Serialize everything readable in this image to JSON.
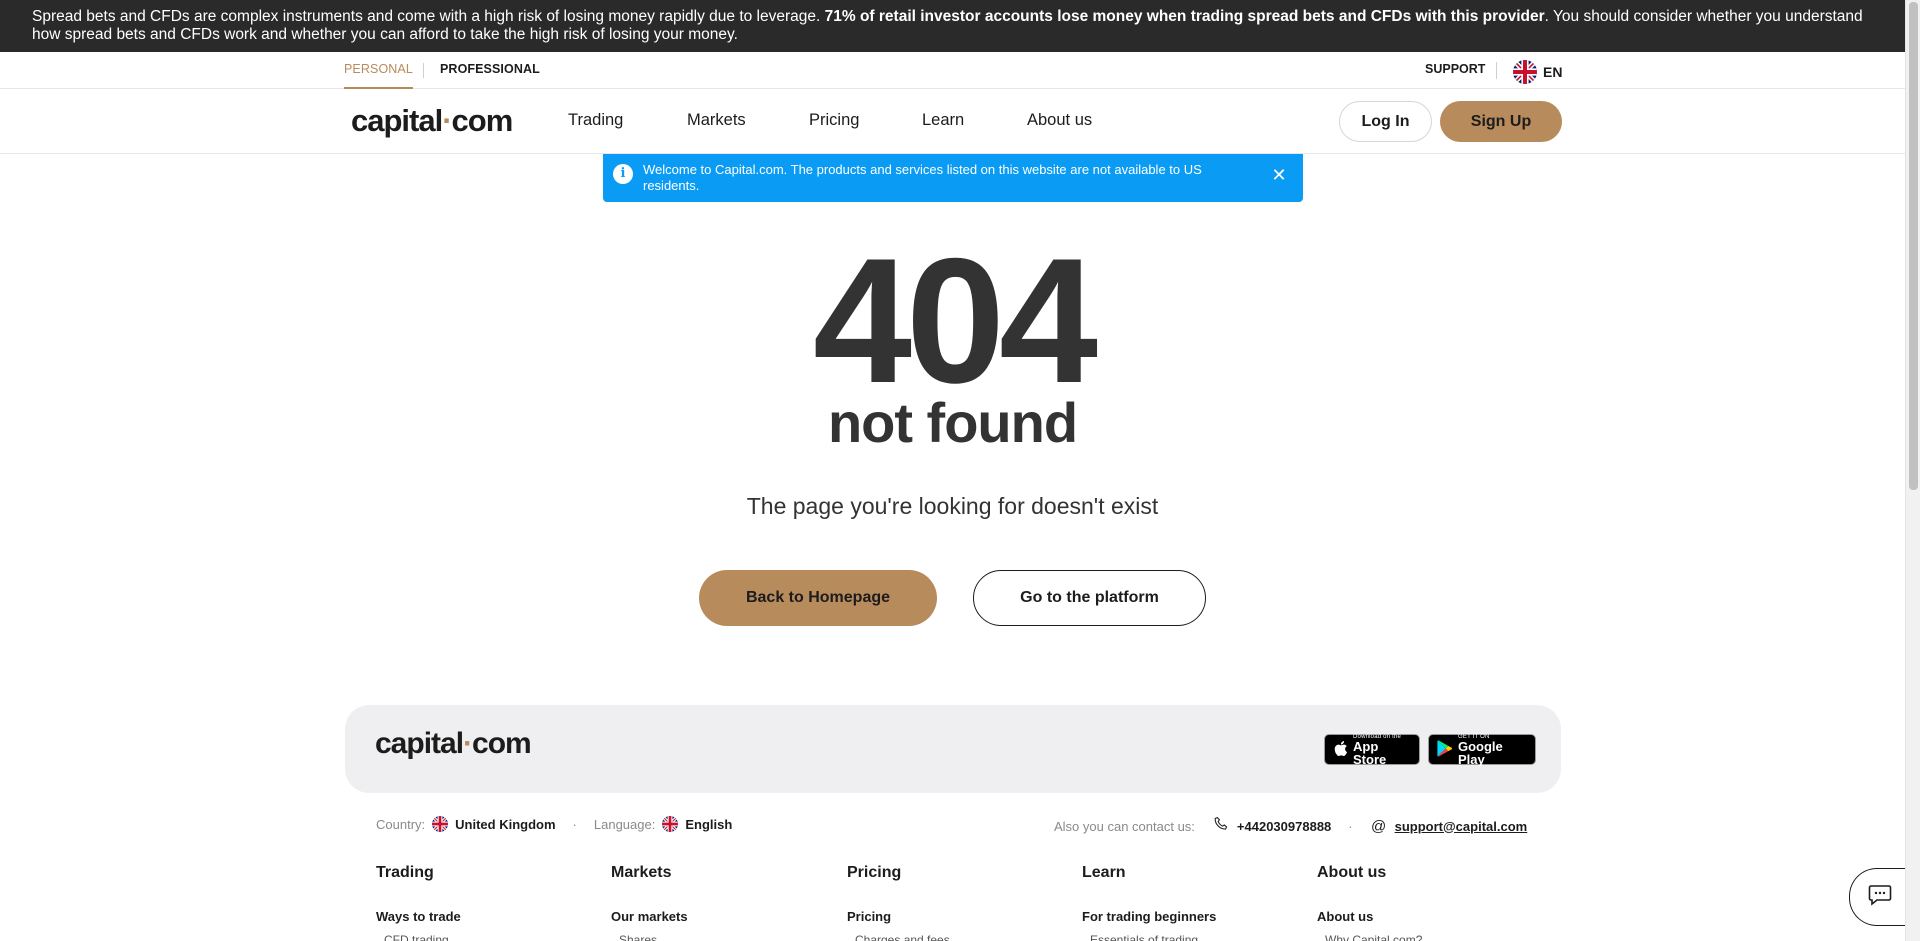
{
  "risk_banner": {
    "text_start": "Spread bets and CFDs are complex instruments and come with a high risk of losing money rapidly due to leverage. ",
    "text_bold": "71% of retail investor accounts lose money when trading spread bets and CFDs with this provider",
    "text_end": ". You should consider whether you understand how spread bets and CFDs work and whether you can afford to take the high risk of losing your money."
  },
  "topbar": {
    "personal": "PERSONAL",
    "professional": "PROFESSIONAL",
    "support": "SUPPORT",
    "language_code": "EN"
  },
  "nav": {
    "logo_left": "capital",
    "logo_dot": "·",
    "logo_right": "com",
    "items": [
      "Trading",
      "Markets",
      "Pricing",
      "Learn",
      "About us"
    ],
    "login": "Log In",
    "signup": "Sign Up"
  },
  "notice": {
    "text": "Welcome to Capital.com. The products and services listed on this website are not available to US residents."
  },
  "error": {
    "code": "404",
    "title": "not found",
    "message": "The page you're looking for doesn't exist",
    "home_button": "Back to Homepage",
    "platform_button": "Go to the platform"
  },
  "footer": {
    "app_store_small": "Download on the",
    "app_store_big": "App Store",
    "google_small": "GET IT ON",
    "google_big": "Google Play",
    "country_label": "Country:",
    "country_value": "United Kingdom",
    "language_label": "Language:",
    "language_value": "English",
    "contact_label": "Also you can contact us:",
    "phone": "+442030978888",
    "email": "support@capital.com",
    "columns": [
      {
        "title": "Trading",
        "link": "Ways to trade",
        "sub": "CFD trading"
      },
      {
        "title": "Markets",
        "link": "Our markets",
        "sub": "Shares"
      },
      {
        "title": "Pricing",
        "link": "Pricing",
        "sub": "Charges and fees"
      },
      {
        "title": "Learn",
        "link": "For trading beginners",
        "sub": "Essentials of trading"
      },
      {
        "title": "About us",
        "link": "About us",
        "sub": "Why Capital.com?"
      }
    ]
  },
  "colors": {
    "accent": "#b88b5c",
    "banner_bg": "#2a2a2a",
    "notice_bg": "#0a9cf5",
    "text": "#1c1c1c"
  }
}
